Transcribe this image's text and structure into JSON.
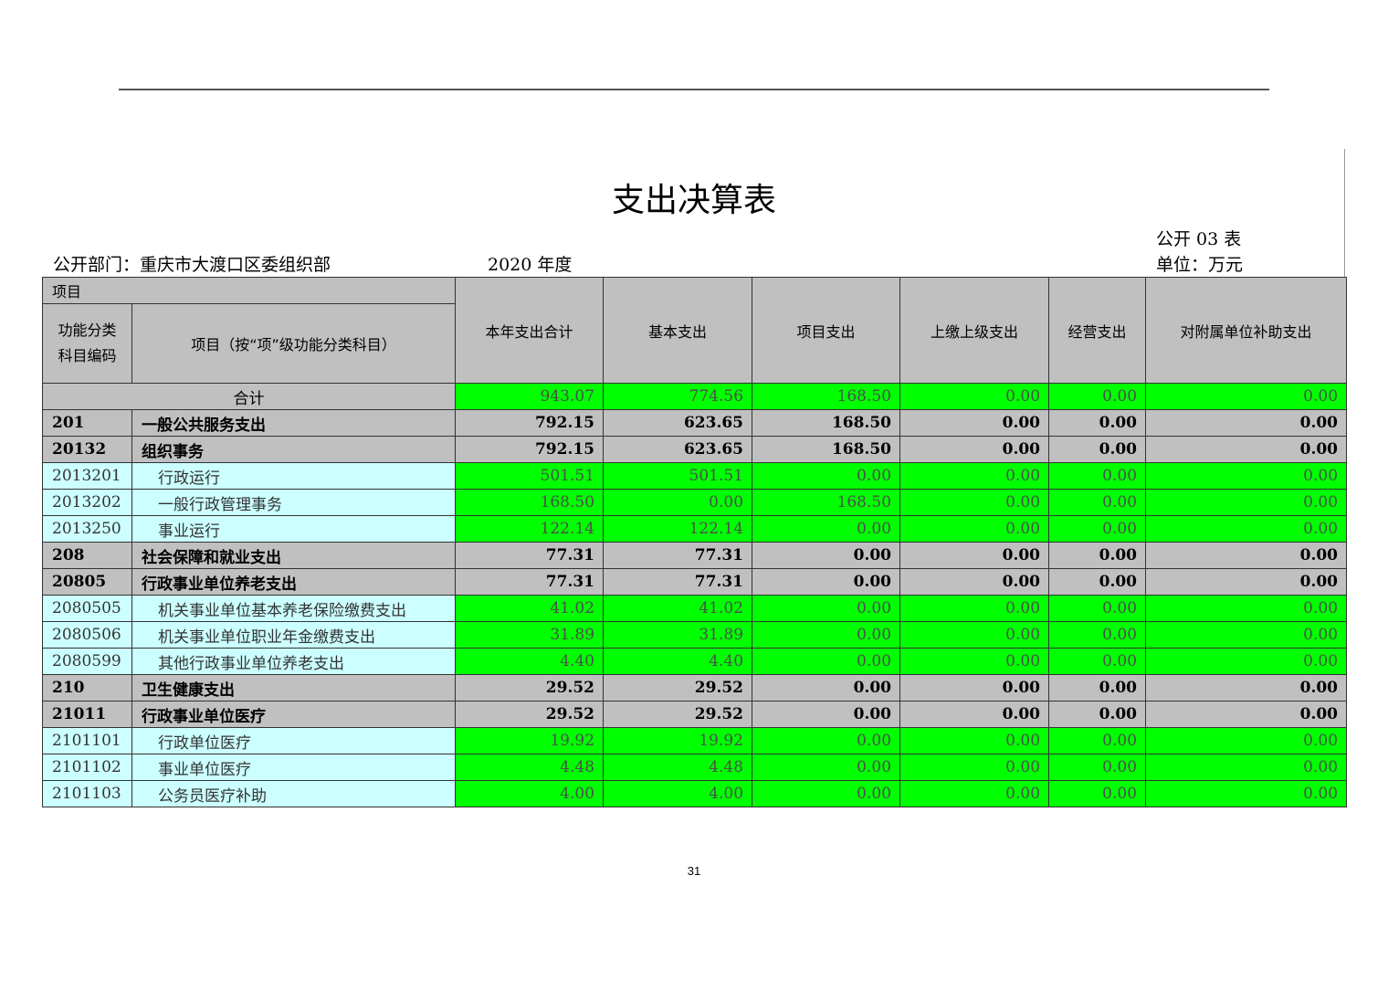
{
  "document": {
    "title": "支出决算表",
    "department": "公开部门：重庆市大渡口区委组织部",
    "year": "2020 年度",
    "form_no": "公开 03 表",
    "unit": "单位：万元",
    "page_number": "31"
  },
  "table": {
    "headers": {
      "project": "项目",
      "code": "功能分类科目编码",
      "name": "项目（按“项”级功能分类科目）",
      "total": "本年支出合计",
      "basic": "基本支出",
      "project_exp": "项目支出",
      "upper": "上缴上级支出",
      "business": "经营支出",
      "subsidiary": "对附属单位补助支出"
    },
    "total_row": {
      "label": "合计",
      "values": [
        "943.07",
        "774.56",
        "168.50",
        "0.00",
        "0.00",
        "0.00"
      ]
    },
    "rows": [
      {
        "type": "grp",
        "code": "201",
        "name": "一般公共服务支出",
        "values": [
          "792.15",
          "623.65",
          "168.50",
          "0.00",
          "0.00",
          "0.00"
        ]
      },
      {
        "type": "grp",
        "code": "20132",
        "name": "组织事务",
        "values": [
          "792.15",
          "623.65",
          "168.50",
          "0.00",
          "0.00",
          "0.00"
        ]
      },
      {
        "type": "item",
        "code": "2013201",
        "name": "行政运行",
        "values": [
          "501.51",
          "501.51",
          "0.00",
          "0.00",
          "0.00",
          "0.00"
        ]
      },
      {
        "type": "item",
        "code": "2013202",
        "name": "一般行政管理事务",
        "values": [
          "168.50",
          "0.00",
          "168.50",
          "0.00",
          "0.00",
          "0.00"
        ]
      },
      {
        "type": "item",
        "code": "2013250",
        "name": "事业运行",
        "values": [
          "122.14",
          "122.14",
          "0.00",
          "0.00",
          "0.00",
          "0.00"
        ]
      },
      {
        "type": "grp",
        "code": "208",
        "name": "社会保障和就业支出",
        "values": [
          "77.31",
          "77.31",
          "0.00",
          "0.00",
          "0.00",
          "0.00"
        ]
      },
      {
        "type": "grp",
        "code": "20805",
        "name": "行政事业单位养老支出",
        "values": [
          "77.31",
          "77.31",
          "0.00",
          "0.00",
          "0.00",
          "0.00"
        ]
      },
      {
        "type": "item",
        "code": "2080505",
        "name": "机关事业单位基本养老保险缴费支出",
        "values": [
          "41.02",
          "41.02",
          "0.00",
          "0.00",
          "0.00",
          "0.00"
        ]
      },
      {
        "type": "item",
        "code": "2080506",
        "name": "机关事业单位职业年金缴费支出",
        "values": [
          "31.89",
          "31.89",
          "0.00",
          "0.00",
          "0.00",
          "0.00"
        ]
      },
      {
        "type": "item",
        "code": "2080599",
        "name": "其他行政事业单位养老支出",
        "values": [
          "4.40",
          "4.40",
          "0.00",
          "0.00",
          "0.00",
          "0.00"
        ]
      },
      {
        "type": "grp",
        "code": "210",
        "name": "卫生健康支出",
        "values": [
          "29.52",
          "29.52",
          "0.00",
          "0.00",
          "0.00",
          "0.00"
        ]
      },
      {
        "type": "grp",
        "code": "21011",
        "name": "行政事业单位医疗",
        "values": [
          "29.52",
          "29.52",
          "0.00",
          "0.00",
          "0.00",
          "0.00"
        ]
      },
      {
        "type": "item",
        "code": "2101101",
        "name": "行政单位医疗",
        "values": [
          "19.92",
          "19.92",
          "0.00",
          "0.00",
          "0.00",
          "0.00"
        ]
      },
      {
        "type": "item",
        "code": "2101102",
        "name": "事业单位医疗",
        "values": [
          "4.48",
          "4.48",
          "0.00",
          "0.00",
          "0.00",
          "0.00"
        ]
      },
      {
        "type": "item",
        "code": "2101103",
        "name": "公务员医疗补助",
        "values": [
          "4.00",
          "4.00",
          "0.00",
          "0.00",
          "0.00",
          "0.00"
        ]
      }
    ]
  }
}
